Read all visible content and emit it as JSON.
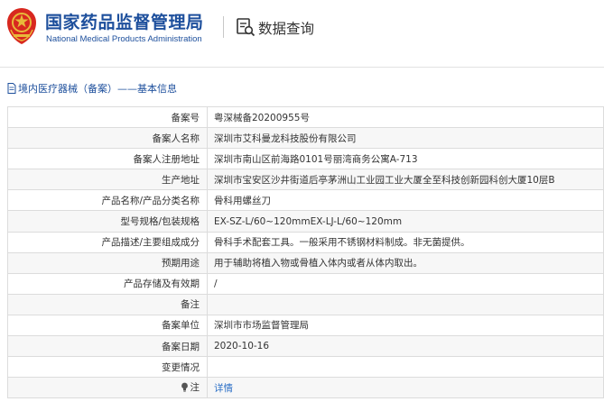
{
  "header": {
    "brand_cn": "国家药品监督管理局",
    "brand_en": "National Medical Products Administration",
    "query_label": "数据查询"
  },
  "breadcrumb": "境内医疗器械（备案）——基本信息",
  "colors": {
    "brand_blue": "#1d4f9c",
    "emblem_red": "#d8281f",
    "emblem_gold": "#e8b93a",
    "link_blue": "#2b6fc6"
  },
  "icons": [
    "national-emblem-icon",
    "search-document-icon",
    "document-icon",
    "lightbulb-icon"
  ],
  "rows": [
    {
      "label": "备案号",
      "value": "粤深械备20200955号"
    },
    {
      "label": "备案人名称",
      "value": "深圳市艾科曼龙科技股份有限公司"
    },
    {
      "label": "备案人注册地址",
      "value": "深圳市南山区前海路0101号丽湾商务公寓A-713"
    },
    {
      "label": "生产地址",
      "value": "深圳市宝安区沙井街道后亭茅洲山工业园工业大厦全至科技创新园科创大厦10层B"
    },
    {
      "label": "产品名称/产品分类名称",
      "value": "骨科用螺丝刀"
    },
    {
      "label": "型号规格/包装规格",
      "value": "EX-SZ-L/60~120mmEX-LJ-L/60~120mm"
    },
    {
      "label": "产品描述/主要组成成分",
      "value": "骨科手术配套工具。一般采用不锈钢材料制成。非无菌提供。"
    },
    {
      "label": "预期用途",
      "value": "用于辅助将植入物或骨植入体内或者从体内取出。"
    },
    {
      "label": "产品存储及有效期",
      "value": "/"
    },
    {
      "label": "备注",
      "value": ""
    },
    {
      "label": "备案单位",
      "value": "深圳市市场监督管理局"
    },
    {
      "label": "备案日期",
      "value": "2020-10-16"
    },
    {
      "label": "变更情况",
      "value": ""
    },
    {
      "label": "注",
      "value": "详情"
    }
  ]
}
